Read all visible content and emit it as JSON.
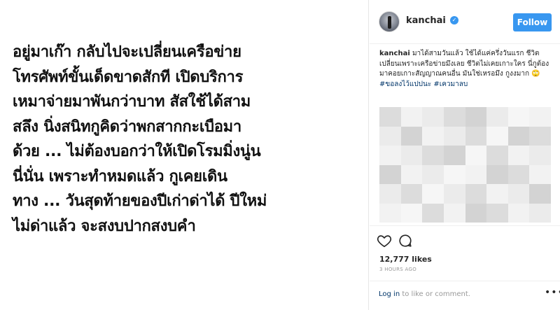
{
  "post": {
    "text": "อยู่มาเก๊า กลับไปจะเปลี่ยนเครือข่าย\nโทรศัพท์ขั้นเด็ดขาดสักที เปิดบริการ\nเหมาจ่ายมาพันกว่าบาท สัสใช้ได้สาม\nสลึง นิ่งสนิทกูคิดว่าพกสากกะเบือมา\nด้วย ... ไม่ต้องบอกว่าให้เปิดโรมมิ่งนู่น\nนี่นั่น เพราะทำหมดแล้ว กูเคยเดิน\nทาง ... วันสุดท้ายของปีเก่าด่าได้ ปีใหม่\nไม่ด่าแล้ว จะสงบปากสงบคำ"
  },
  "header": {
    "username": "kanchai",
    "verified_mark": "✓",
    "follow_label": "Follow"
  },
  "caption": {
    "username": "kanchai",
    "text": "มาได้สามวันแล้ว ใช้ได้แค่ครึ่งวันแรก ชีวิตเปลี่ยนเพราะเครือข่ายมึงเลย ชีวิตไม่เคยเกาะใคร นี่กูต้องมาคอยเกาะสัญญาณคนอื่น มันใช่เหรอมึง กูงงมาก",
    "hashtags": "#ขอลงไว้แปปนะ #เควมาลบ"
  },
  "stats": {
    "likes": "12,777 likes",
    "timestamp": "3 HOURS AGO"
  },
  "comment": {
    "login_label": "Log in",
    "suffix": " to like or comment.",
    "more": "•••"
  },
  "colors": {
    "accent": "#3897f0",
    "link": "#003569",
    "muted": "#999999"
  }
}
